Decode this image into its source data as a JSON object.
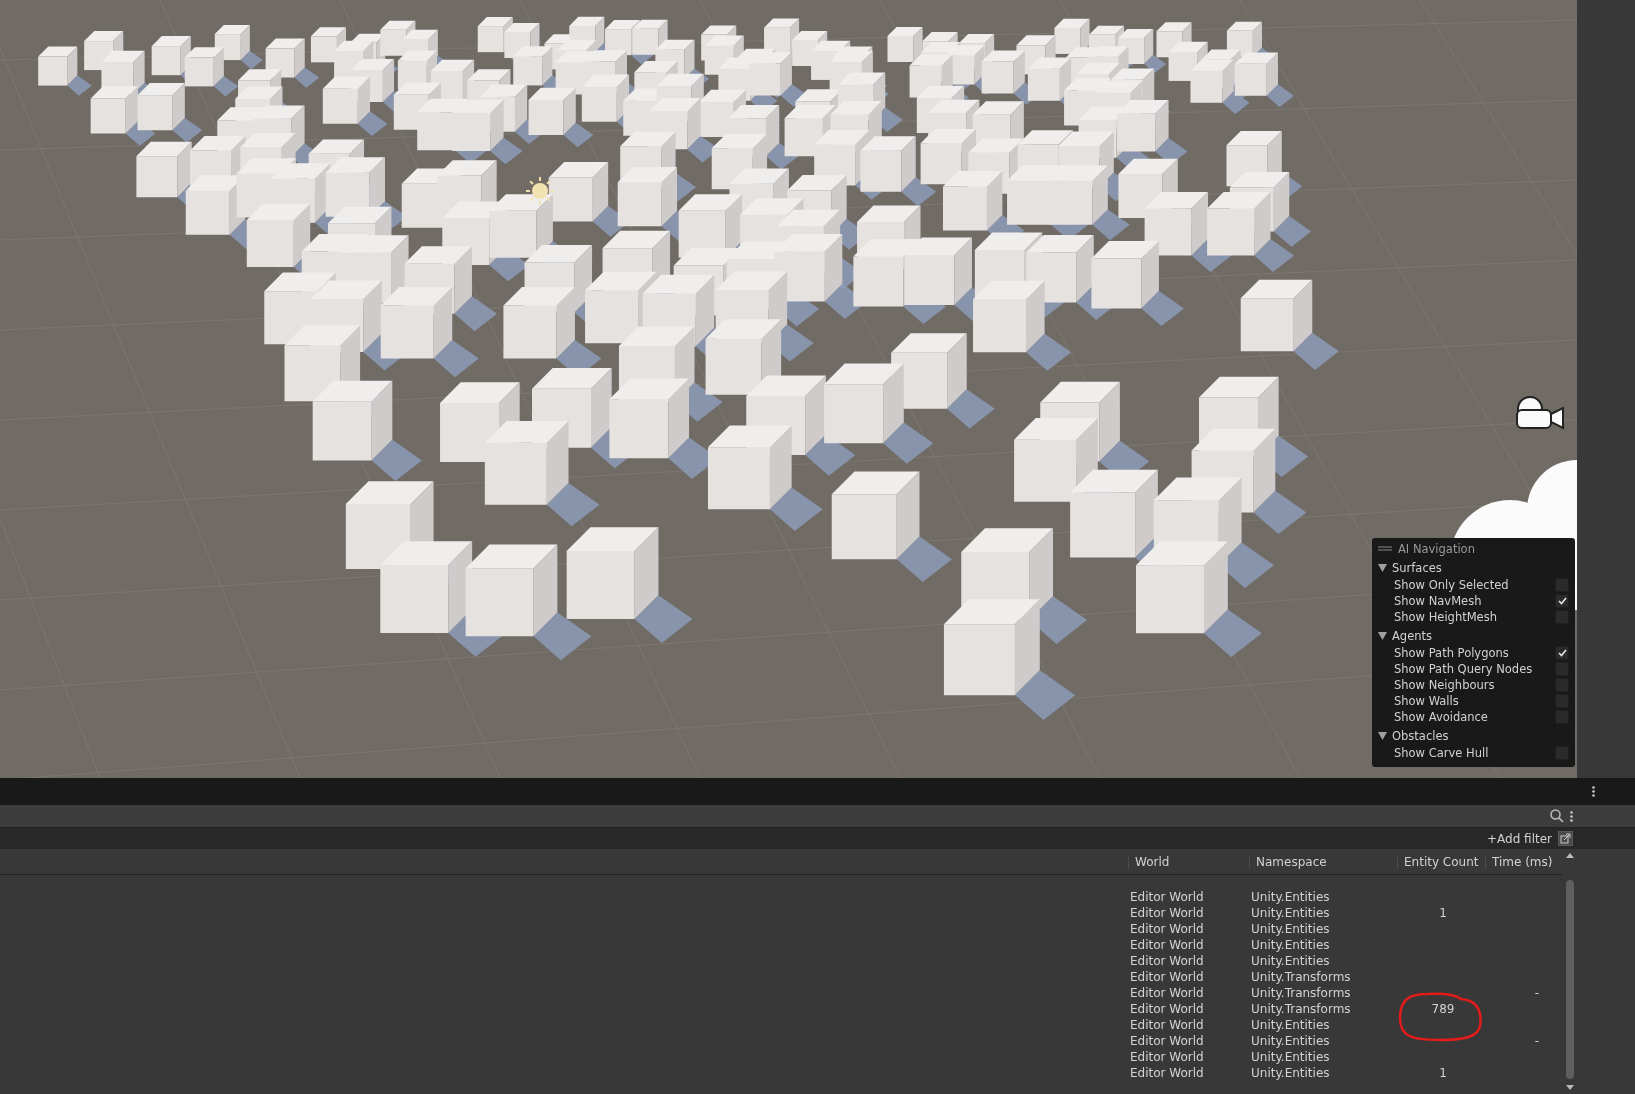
{
  "overlay": {
    "title": "AI Navigation",
    "sections": [
      {
        "title": "Surfaces",
        "expanded": true,
        "items": [
          {
            "label": "Show Only Selected",
            "checked": false
          },
          {
            "label": "Show NavMesh",
            "checked": true
          },
          {
            "label": "Show HeightMesh",
            "checked": false
          }
        ]
      },
      {
        "title": "Agents",
        "expanded": true,
        "items": [
          {
            "label": "Show Path Polygons",
            "checked": true
          },
          {
            "label": "Show Path Query Nodes",
            "checked": false
          },
          {
            "label": "Show Neighbours",
            "checked": false
          },
          {
            "label": "Show Walls",
            "checked": false
          },
          {
            "label": "Show Avoidance",
            "checked": false
          }
        ]
      },
      {
        "title": "Obstacles",
        "expanded": true,
        "items": [
          {
            "label": "Show Carve Hull",
            "checked": false
          }
        ]
      }
    ]
  },
  "filter_bar": {
    "add_filter": "+Add filter"
  },
  "table": {
    "columns": [
      "World",
      "Namespace",
      "Entity Count",
      "Time (ms)"
    ],
    "rows": [
      {
        "world": "Editor World",
        "namespace": "Unity.Entities"
      },
      {
        "world": "Editor World",
        "namespace": "Unity.Entities",
        "entity_count": "1"
      },
      {
        "world": "Editor World",
        "namespace": "Unity.Entities"
      },
      {
        "world": "Editor World",
        "namespace": "Unity.Entities"
      },
      {
        "world": "Editor World",
        "namespace": "Unity.Entities"
      },
      {
        "world": "Editor World",
        "namespace": "Unity.Transforms"
      },
      {
        "world": "Editor World",
        "namespace": "Unity.Transforms",
        "time": "-"
      },
      {
        "world": "Editor World",
        "namespace": "Unity.Transforms",
        "entity_count": "789",
        "circled": true
      },
      {
        "world": "Editor World",
        "namespace": "Unity.Entities"
      },
      {
        "world": "Editor World",
        "namespace": "Unity.Entities",
        "time": "-"
      },
      {
        "world": "Editor World",
        "namespace": "Unity.Entities"
      },
      {
        "world": "Editor World",
        "namespace": "Unity.Entities",
        "entity_count": "1"
      }
    ]
  }
}
